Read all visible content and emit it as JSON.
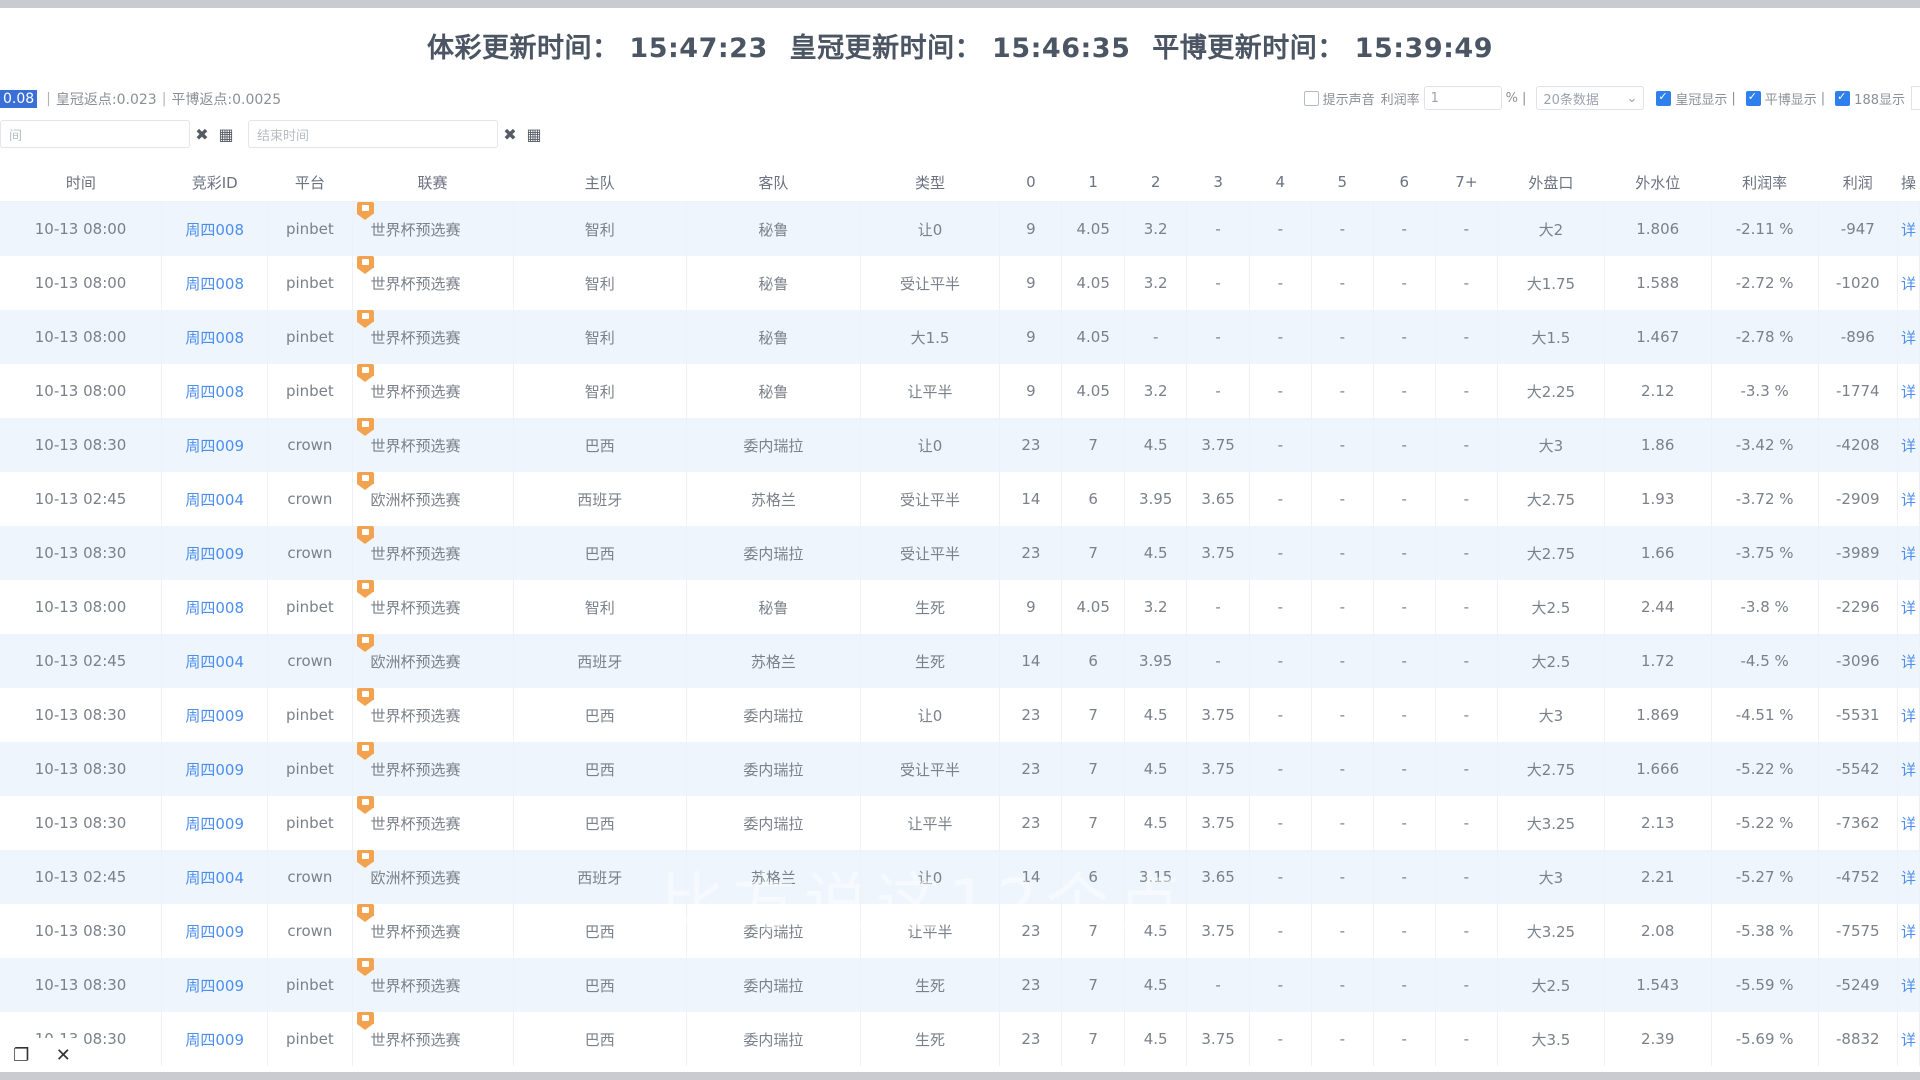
{
  "header": {
    "segments": [
      "体彩更新时间： 15:47:23",
      "皇冠更新时间： 15:46:35",
      "平博更新时间： 15:39:49"
    ]
  },
  "info": {
    "highlight": "0.08",
    "crown_rebate": "皇冠返点:0.023",
    "pinbet_rebate": "平博返点:0.0025"
  },
  "controls": {
    "sound_label": "提示声音",
    "profit_label": "利润率",
    "profit_value": "1",
    "percent_label": "%",
    "page_size": "20条数据",
    "crown_show": "皇冠显示",
    "pinbet_show": "平博显示",
    "b188_show": "188显示"
  },
  "filters": {
    "start_placeholder": "间",
    "end_placeholder": "结束时间"
  },
  "table": {
    "headers": [
      "时间",
      "竞彩ID",
      "平台",
      "联赛",
      "主队",
      "客队",
      "类型",
      "0",
      "1",
      "2",
      "3",
      "4",
      "5",
      "6",
      "7+",
      "外盘口",
      "外水位",
      "利润率",
      "利润",
      "操"
    ],
    "rows": [
      [
        "10-13 08:00",
        "周四008",
        "pinbet",
        "世界杯预选赛",
        "智利",
        "秘鲁",
        "让0",
        "9",
        "4.05",
        "3.2",
        "-",
        "-",
        "-",
        "-",
        "-",
        "大2",
        "1.806",
        "-2.11 %",
        "-947",
        "详"
      ],
      [
        "10-13 08:00",
        "周四008",
        "pinbet",
        "世界杯预选赛",
        "智利",
        "秘鲁",
        "受让平半",
        "9",
        "4.05",
        "3.2",
        "-",
        "-",
        "-",
        "-",
        "-",
        "大1.75",
        "1.588",
        "-2.72 %",
        "-1020",
        "详"
      ],
      [
        "10-13 08:00",
        "周四008",
        "pinbet",
        "世界杯预选赛",
        "智利",
        "秘鲁",
        "大1.5",
        "9",
        "4.05",
        "-",
        "-",
        "-",
        "-",
        "-",
        "-",
        "大1.5",
        "1.467",
        "-2.78 %",
        "-896",
        "详"
      ],
      [
        "10-13 08:00",
        "周四008",
        "pinbet",
        "世界杯预选赛",
        "智利",
        "秘鲁",
        "让平半",
        "9",
        "4.05",
        "3.2",
        "-",
        "-",
        "-",
        "-",
        "-",
        "大2.25",
        "2.12",
        "-3.3 %",
        "-1774",
        "详"
      ],
      [
        "10-13 08:30",
        "周四009",
        "crown",
        "世界杯预选赛",
        "巴西",
        "委内瑞拉",
        "让0",
        "23",
        "7",
        "4.5",
        "3.75",
        "-",
        "-",
        "-",
        "-",
        "大3",
        "1.86",
        "-3.42 %",
        "-4208",
        "详"
      ],
      [
        "10-13 02:45",
        "周四004",
        "crown",
        "欧洲杯预选赛",
        "西班牙",
        "苏格兰",
        "受让平半",
        "14",
        "6",
        "3.95",
        "3.65",
        "-",
        "-",
        "-",
        "-",
        "大2.75",
        "1.93",
        "-3.72 %",
        "-2909",
        "详"
      ],
      [
        "10-13 08:30",
        "周四009",
        "crown",
        "世界杯预选赛",
        "巴西",
        "委内瑞拉",
        "受让平半",
        "23",
        "7",
        "4.5",
        "3.75",
        "-",
        "-",
        "-",
        "-",
        "大2.75",
        "1.66",
        "-3.75 %",
        "-3989",
        "详"
      ],
      [
        "10-13 08:00",
        "周四008",
        "pinbet",
        "世界杯预选赛",
        "智利",
        "秘鲁",
        "生死",
        "9",
        "4.05",
        "3.2",
        "-",
        "-",
        "-",
        "-",
        "-",
        "大2.5",
        "2.44",
        "-3.8 %",
        "-2296",
        "详"
      ],
      [
        "10-13 02:45",
        "周四004",
        "crown",
        "欧洲杯预选赛",
        "西班牙",
        "苏格兰",
        "生死",
        "14",
        "6",
        "3.95",
        "-",
        "-",
        "-",
        "-",
        "-",
        "大2.5",
        "1.72",
        "-4.5 %",
        "-3096",
        "详"
      ],
      [
        "10-13 08:30",
        "周四009",
        "pinbet",
        "世界杯预选赛",
        "巴西",
        "委内瑞拉",
        "让0",
        "23",
        "7",
        "4.5",
        "3.75",
        "-",
        "-",
        "-",
        "-",
        "大3",
        "1.869",
        "-4.51 %",
        "-5531",
        "详"
      ],
      [
        "10-13 08:30",
        "周四009",
        "pinbet",
        "世界杯预选赛",
        "巴西",
        "委内瑞拉",
        "受让平半",
        "23",
        "7",
        "4.5",
        "3.75",
        "-",
        "-",
        "-",
        "-",
        "大2.75",
        "1.666",
        "-5.22 %",
        "-5542",
        "详"
      ],
      [
        "10-13 08:30",
        "周四009",
        "pinbet",
        "世界杯预选赛",
        "巴西",
        "委内瑞拉",
        "让平半",
        "23",
        "7",
        "4.5",
        "3.75",
        "-",
        "-",
        "-",
        "-",
        "大3.25",
        "2.13",
        "-5.22 %",
        "-7362",
        "详"
      ],
      [
        "10-13 02:45",
        "周四004",
        "crown",
        "欧洲杯预选赛",
        "西班牙",
        "苏格兰",
        "让0",
        "14",
        "6",
        "3.15",
        "3.65",
        "-",
        "-",
        "-",
        "-",
        "大3",
        "2.21",
        "-5.27 %",
        "-4752",
        "详"
      ],
      [
        "10-13 08:30",
        "周四009",
        "crown",
        "世界杯预选赛",
        "巴西",
        "委内瑞拉",
        "让平半",
        "23",
        "7",
        "4.5",
        "3.75",
        "-",
        "-",
        "-",
        "-",
        "大3.25",
        "2.08",
        "-5.38 %",
        "-7575",
        "详"
      ],
      [
        "10-13 08:30",
        "周四009",
        "pinbet",
        "世界杯预选赛",
        "巴西",
        "委内瑞拉",
        "生死",
        "23",
        "7",
        "4.5",
        "-",
        "-",
        "-",
        "-",
        "-",
        "大2.5",
        "1.543",
        "-5.59 %",
        "-5249",
        "详"
      ],
      [
        "10-13 08:30",
        "周四009",
        "pinbet",
        "世界杯预选赛",
        "巴西",
        "委内瑞拉",
        "生死",
        "23",
        "7",
        "4.5",
        "3.75",
        "-",
        "-",
        "-",
        "-",
        "大3.5",
        "2.39",
        "-5.69 %",
        "-8832",
        "详"
      ]
    ]
  },
  "watermark": "比方说这12个点"
}
